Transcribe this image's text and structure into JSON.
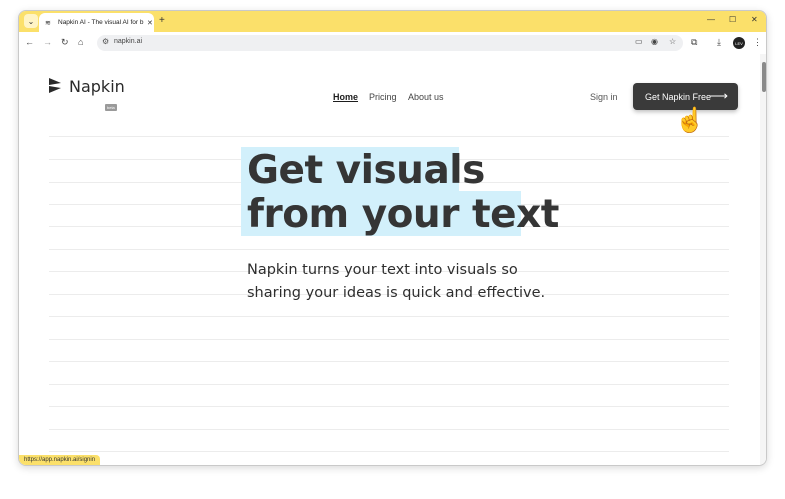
{
  "browser": {
    "tab_title": "Napkin AI - The visual AI for b",
    "url": "napkin.ai",
    "status_url": "https://app.napkin.ai/signin",
    "avatar_label": "LEV"
  },
  "site": {
    "logo_text": "Napkin",
    "beta_badge": "beta",
    "nav": {
      "home": "Home",
      "pricing": "Pricing",
      "about": "About us"
    },
    "signin": "Sign in",
    "cta": "Get Napkin Free"
  },
  "hero": {
    "line1": "Get visuals",
    "line2": "from your text",
    "description": "Napkin turns your text into visuals so sharing your ideas is quick and effective."
  },
  "colors": {
    "titlebar": "#fbe06a",
    "highlight": "#d2f0fb",
    "cta_bg": "#3a3a3a",
    "cursor": "#5aa0d8"
  }
}
